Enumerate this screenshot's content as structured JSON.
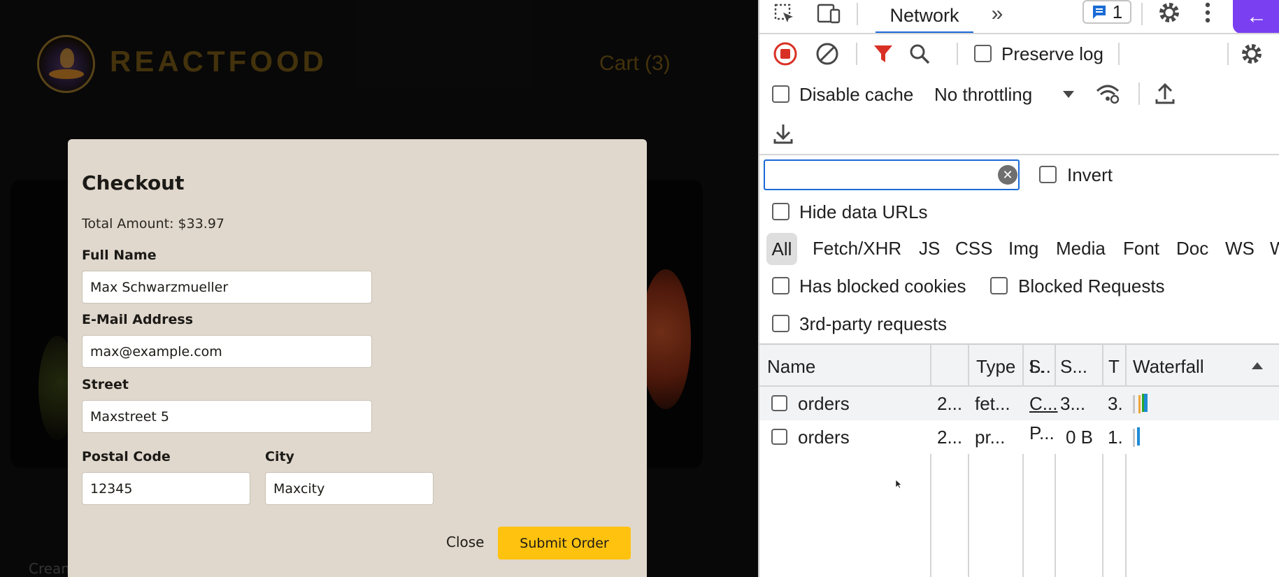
{
  "app": {
    "logo_text": "REACTFOOD",
    "cart_label": "Cart (3)",
    "meal_caption": "Crean"
  },
  "modal": {
    "title": "Checkout",
    "total": "Total Amount: $33.97",
    "fields": {
      "full_name": {
        "label": "Full Name",
        "value": "Max Schwarzmueller"
      },
      "email": {
        "label": "E-Mail Address",
        "value": "max@example.com"
      },
      "street": {
        "label": "Street",
        "value": "Maxstreet 5"
      },
      "postal_code": {
        "label": "Postal Code",
        "value": "12345"
      },
      "city": {
        "label": "City",
        "value": "Maxcity"
      }
    },
    "close_label": "Close",
    "submit_label": "Submit Order",
    "colors": {
      "modal_bg": "#e0d8cd",
      "submit_bg": "#ffc20f",
      "brand": "#7a5b16"
    }
  },
  "devtools": {
    "active_tab": "Network",
    "issues_count": "1",
    "toolbar": {
      "preserve_log": "Preserve log",
      "disable_cache": "Disable cache",
      "throttling": "No throttling"
    },
    "filter": {
      "value": "",
      "invert_label": "Invert",
      "hide_data_urls": "Hide data URLs"
    },
    "type_filters": [
      "All",
      "Fetch/XHR",
      "JS",
      "CSS",
      "Img",
      "Media",
      "Font",
      "Doc",
      "WS",
      "W"
    ],
    "checks": {
      "has_blocked_cookies": "Has blocked cookies",
      "blocked_requests": "Blocked Requests",
      "third_party": "3rd-party requests"
    },
    "table": {
      "columns": [
        "Name",
        "S..",
        "Type",
        "I..",
        "S...",
        "T",
        "Waterfall"
      ],
      "rows": [
        {
          "name": "orders",
          "status": "2...",
          "type": "fet...",
          "initiator": "C...",
          "size": "3...",
          "time": "3."
        },
        {
          "name": "orders",
          "status": "2...",
          "type": "pr...",
          "initiator": "P...",
          "size": "0 B",
          "time": "1."
        }
      ]
    },
    "colors": {
      "accent": "#1a6bd6",
      "record": "#d93025",
      "filter": "#d93025",
      "back": "#7b3ff2"
    }
  }
}
